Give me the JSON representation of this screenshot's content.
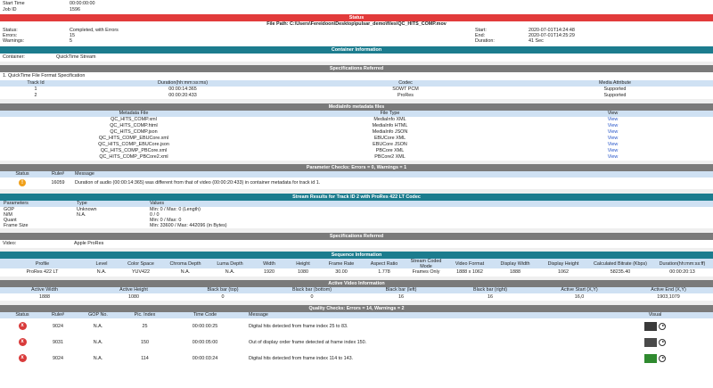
{
  "top": {
    "start_time_label": "Start Time",
    "start_time_value": "00:00:00:00",
    "job_id_label": "Job ID",
    "job_id_value": "1596"
  },
  "status": {
    "title": "Status",
    "file_path": "File Path: C:\\Users\\Fereidoon\\Desktop\\pulsar_demo\\files\\QC_HITS_COMP.mov",
    "status_label": "Status:",
    "status_value": "Completed, with Errors",
    "errors_label": "Errors:",
    "errors_value": "15",
    "warnings_label": "Warnings:",
    "warnings_value": "5",
    "start_label": "Start:",
    "start_value": "2020-07-01T14:24:48",
    "end_label": "End:",
    "end_value": "2020-07-01T14:25:29",
    "duration_label": "Duration:",
    "duration_value": "41 Sec"
  },
  "container": {
    "title": "Container Information",
    "label": "Container:",
    "value": "QuickTime Stream"
  },
  "specs": {
    "title": "Specifications Referred",
    "item": "1. QuickTime File Format Specification"
  },
  "tracks": {
    "headers": [
      "Track Id",
      "Duration(hh:mm:ss:ms)",
      "Codec",
      "Media Attribute"
    ],
    "rows": [
      [
        "1",
        "00:00:14:365",
        "SOWT PCM",
        "Supported"
      ],
      [
        "2",
        "00:00:20:433",
        "ProRes",
        "Supported"
      ]
    ]
  },
  "mediainfo": {
    "title": "MediaInfo metadata files",
    "headers": [
      "Metadata File",
      "File Type",
      "View"
    ],
    "rows": [
      [
        "QC_HITS_COMP.xml",
        "MediaInfo XML",
        "View"
      ],
      [
        "QC_HITS_COMP.html",
        "MediaInfo HTML",
        "View"
      ],
      [
        "QC_HITS_COMP.json",
        "MediaInfo JSON",
        "View"
      ],
      [
        "QC_HITS_COMP_EBUCore.xml",
        "EBUCore XML",
        "View"
      ],
      [
        "QC_HITS_COMP_EBUCore.json",
        "EBUCore JSON",
        "View"
      ],
      [
        "QC_HITS_COMP_PBCore.xml",
        "PBCore XML",
        "View"
      ],
      [
        "QC_HITS_COMP_PBCore2.xml",
        "PBCore2 XML",
        "View"
      ]
    ]
  },
  "param_checks": {
    "title": "Parameter Checks: Errors = 0, Warnings = 1",
    "headers": [
      "Status",
      "Rule#",
      "Message"
    ],
    "rows": [
      [
        "!",
        "16059",
        "Duration of audio (00:00:14:365) was different from that of video (00:00:20:433) in container metadata for track id 1."
      ]
    ]
  },
  "stream": {
    "title": "Stream Results for Track ID 2 with ProRes 422 LT Codec",
    "headers": [
      "Parameters",
      "Type",
      "Values"
    ],
    "rows": [
      [
        "GOP",
        "Unknown",
        "Min: 0 / Max: 0 (Length)"
      ],
      [
        "N/M",
        "N.A.",
        "0 / 0"
      ],
      [
        "Quant",
        "",
        "Min: 0 / Max: 0"
      ],
      [
        "Frame Size",
        "",
        "Min: 33600 / Max: 442096 (in Bytes)"
      ]
    ]
  },
  "specs2": {
    "title": "Specifications Referred",
    "label": "Video:",
    "value": "Apple ProRes"
  },
  "sequence": {
    "title": "Sequence Information",
    "headers": [
      "Profile",
      "Level",
      "Color Space",
      "Chroma Depth",
      "Luma Depth",
      "Width",
      "Height",
      "Frame Rate",
      "Aspect Ratio",
      "Stream Coded Mode",
      "Video Format",
      "Display Width",
      "Display Height",
      "Calculated Bitrate (Kbps)",
      "Duration(hh:mm:ss:ff)"
    ],
    "row": [
      "ProRes 422 LT",
      "N.A.",
      "YUV422",
      "N.A.",
      "N.A.",
      "1920",
      "1080",
      "30.00",
      "1.778",
      "Frames Only",
      "1888 x 1062",
      "1888",
      "1062",
      "58235.40",
      "00:00:20:13"
    ]
  },
  "active_video": {
    "title": "Active Video Information",
    "headers": [
      "Active Width",
      "Active Height",
      "Black bar (top)",
      "Black bar (bottom)",
      "Black bar (left)",
      "Black bar (right)",
      "Active Start (X,Y)",
      "Active End (X,Y)"
    ],
    "row": [
      "1888",
      "1080",
      "0",
      "0",
      "16",
      "16",
      "16,0",
      "1903,1079"
    ]
  },
  "quality": {
    "title": "Quality Checks: Errors = 14, Warnings = 2",
    "headers": [
      "Status",
      "Rule#",
      "GOP No.",
      "Pic. Index",
      "Time Code",
      "Message",
      "Visual"
    ],
    "rows": [
      [
        "x",
        "9024",
        "N.A.",
        "25",
        "00:00:00:25",
        "Digital hits detected from frame index 25 to 83."
      ],
      [
        "x",
        "9031",
        "N.A.",
        "150",
        "00:00:05:00",
        "Out of display order frame detected at frame index 150."
      ],
      [
        "x",
        "9024",
        "N.A.",
        "114",
        "00:00:03:24",
        "Digital hits detected from frame index 114 to 143."
      ]
    ]
  },
  "colors": {
    "status_bar": "#e23b3b",
    "teal_bar": "#1c7c8e",
    "gray_bar": "#7a7a7a",
    "header_row": "#cfe1f3",
    "link": "#2a57c9"
  }
}
